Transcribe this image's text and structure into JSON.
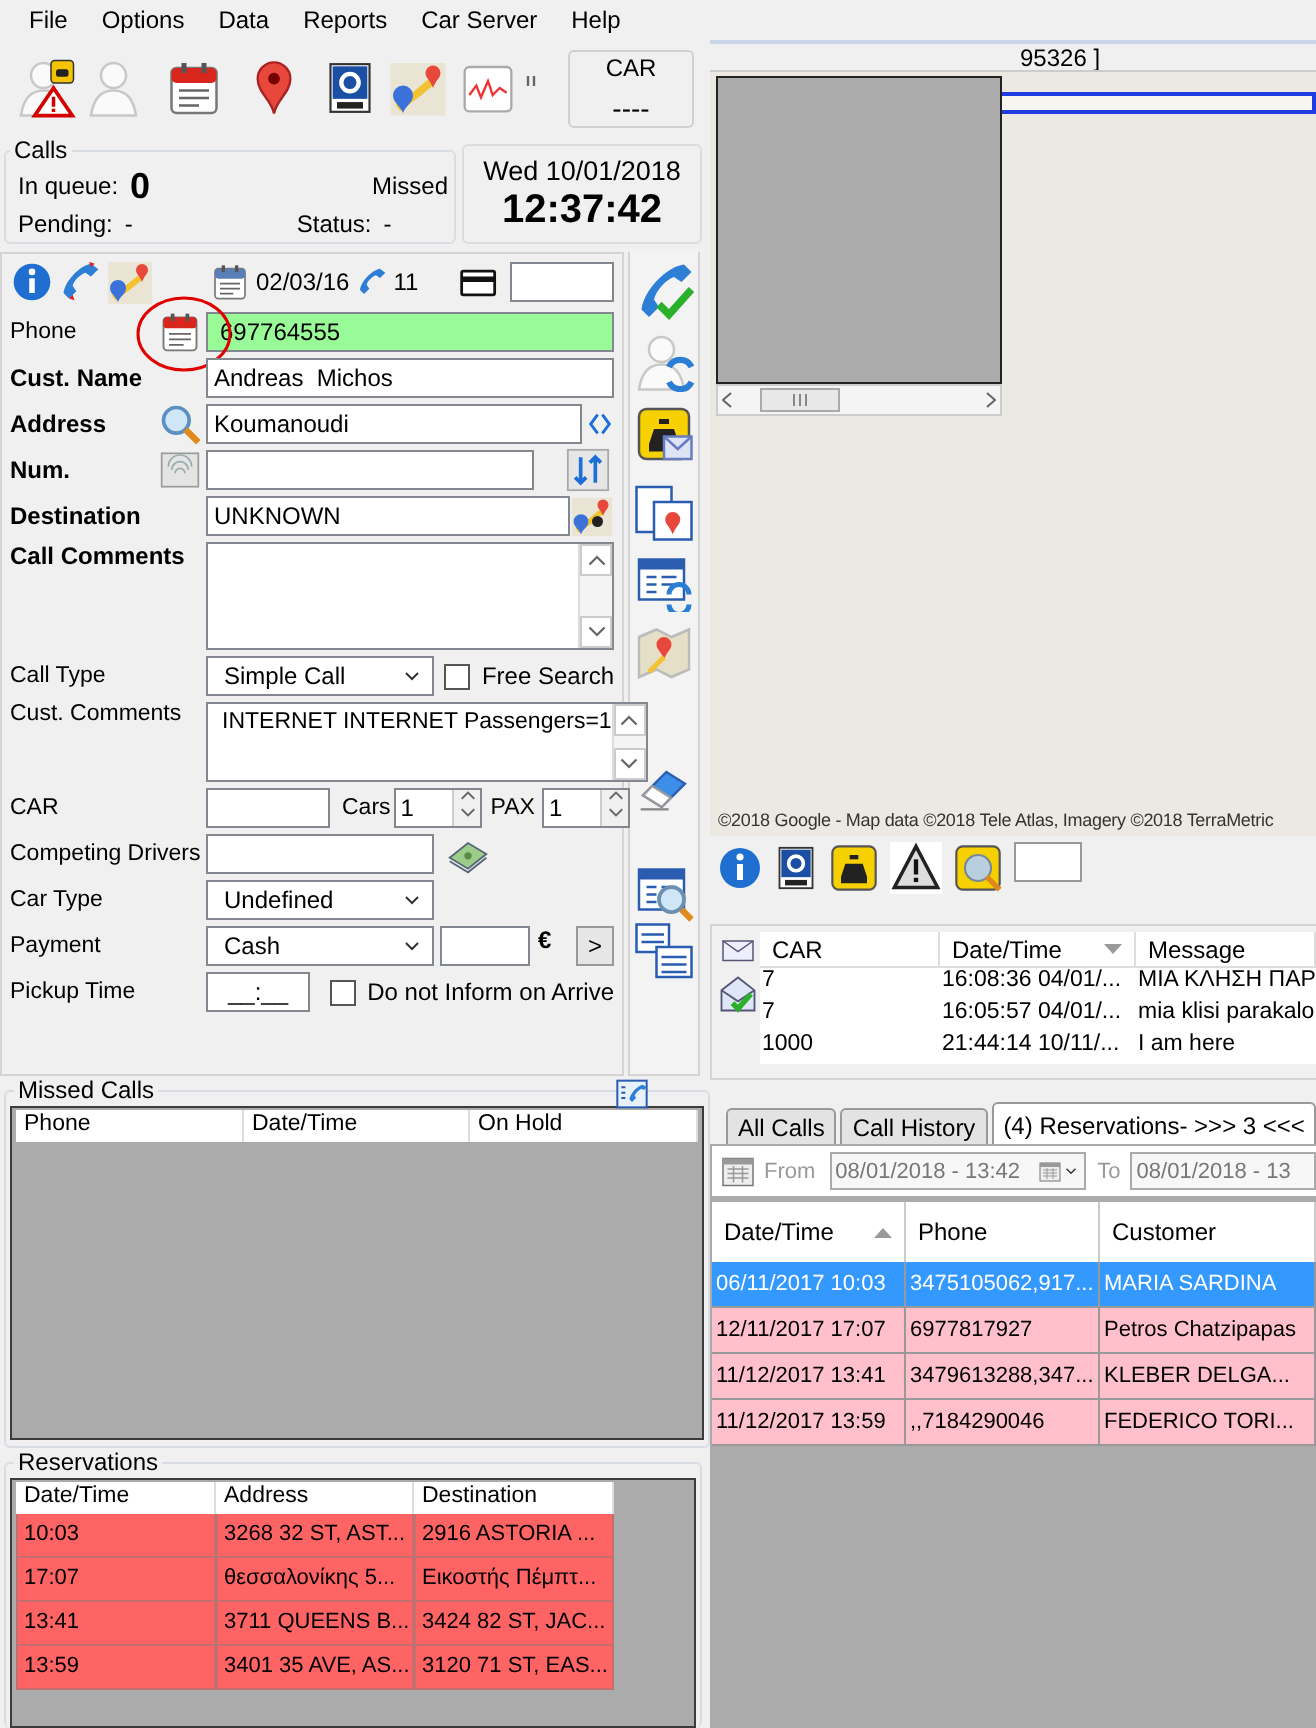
{
  "menu": [
    "File",
    "Options",
    "Data",
    "Reports",
    "Car Server",
    "Help"
  ],
  "car_box": {
    "title": "CAR",
    "value": "----"
  },
  "calls": {
    "title": "Calls",
    "in_queue_label": "In queue:",
    "in_queue": "0",
    "missed_label": "Missed",
    "pending_label": "Pending:",
    "pending": "-",
    "status_label": "Status:",
    "status": "-"
  },
  "clock": {
    "date": "Wed 10/01/2018",
    "time": "12:37:42"
  },
  "form": {
    "info": {
      "date": "02/03/16",
      "count": "11"
    },
    "phone": {
      "label": "Phone",
      "value": "697764555"
    },
    "customer_name": {
      "label": "Cust. Name",
      "value": "Andreas  Michos"
    },
    "address": {
      "label": "Address",
      "value": "Koumanoudi"
    },
    "number": {
      "label": "Num."
    },
    "destination": {
      "label": "Destination",
      "value": "UNKNOWN"
    },
    "call_comments": {
      "label": "Call Comments"
    },
    "call_type": {
      "label": "Call Type",
      "value": "Simple Call"
    },
    "free_search": {
      "label": "Free Search",
      "checked": false
    },
    "cust_comments": {
      "label": "Cust. Comments",
      "value": "INTERNET INTERNET Passengers=1"
    },
    "car": {
      "label": "CAR"
    },
    "cars": {
      "label": "Cars",
      "value": "1"
    },
    "pax": {
      "label": "PAX",
      "value": "1"
    },
    "competing_drivers": {
      "label": "Competing Drivers"
    },
    "car_type": {
      "label": "Car Type",
      "value": "Undefined"
    },
    "payment": {
      "label": "Payment",
      "value": "Cash",
      "currency": "€",
      "go": ">"
    },
    "pickup_time": {
      "label": "Pickup Time",
      "value": "__:__"
    },
    "do_not_inform": {
      "label": "Do not Inform on Arrive",
      "checked": false
    }
  },
  "missed_calls": {
    "title": "Missed Calls",
    "columns": [
      "Phone",
      "Date/Time",
      "On Hold"
    ]
  },
  "reservations": {
    "title": "Reservations",
    "columns": [
      "Date/Time",
      "Address",
      "Destination"
    ],
    "rows": [
      [
        "10:03",
        "3268 32 ST, AST...",
        "2916 ASTORIA ..."
      ],
      [
        "17:07",
        "θεσσαλονίκης 5...",
        "Εικοστής Πέμπτ..."
      ],
      [
        "13:41",
        "3711 QUEENS B...",
        "3424 82 ST, JAC..."
      ],
      [
        "13:59",
        "3401 35 AVE, AS...",
        "3120 71 ST, EAS..."
      ]
    ]
  },
  "map": {
    "title_fragment": "95326 ]",
    "copyright": "©2018 Google - Map data ©2018 Tele Atlas, Imagery ©2018 TerraMetric"
  },
  "messages": {
    "columns": [
      {
        "label": "CAR",
        "sorted": false
      },
      {
        "label": "Date/Time",
        "sorted": true,
        "descending": true
      },
      {
        "label": "Message",
        "sorted": false
      }
    ],
    "rows": [
      [
        "7",
        "16:08:36 04/01/...",
        "ΜΙΑ ΚΛΗΣΗ ΠΑΡ"
      ],
      [
        "7",
        "16:05:57 04/01/...",
        "mia klisi parakalo"
      ],
      [
        "1000",
        "21:44:14 10/11/...",
        "I am here"
      ]
    ]
  },
  "booking": {
    "tabs": [
      {
        "label": "All Calls",
        "selected": false
      },
      {
        "label": "Call History",
        "selected": false
      },
      {
        "label": "(4) Reservations- >>> 3 <<<",
        "selected": true
      }
    ],
    "filter": {
      "from_label": "From",
      "from": "08/01/2018 - 13:42",
      "to_label": "To",
      "to": "08/01/2018 - 13",
      "disabled": true
    },
    "grid": {
      "columns": [
        {
          "label": "Date/Time",
          "sorted": true,
          "descending": false
        },
        {
          "label": "Phone",
          "sorted": false
        },
        {
          "label": "Customer",
          "sorted": false
        }
      ],
      "rows": [
        {
          "cells": [
            "06/11/2017 10:03",
            "3475105062,917...",
            "MARIA SARDINA"
          ],
          "selected": true
        },
        {
          "cells": [
            "12/11/2017 17:07",
            "6977817927",
            "Petros Chatzipapas"
          ],
          "selected": false
        },
        {
          "cells": [
            "11/12/2017 13:41",
            "3479613288,347...",
            "KLEBER DELGA..."
          ],
          "selected": false
        },
        {
          "cells": [
            "11/12/2017 13:59",
            ",,7184290046",
            "FEDERICO TORI..."
          ],
          "selected": false
        }
      ]
    }
  }
}
